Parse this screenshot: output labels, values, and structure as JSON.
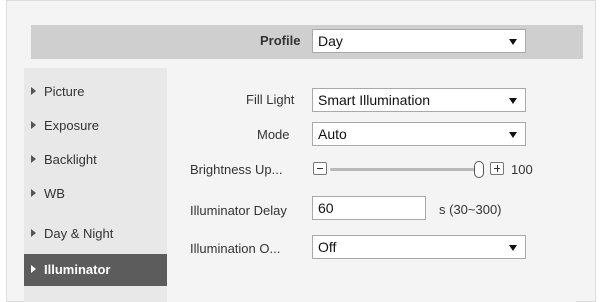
{
  "profile": {
    "label": "Profile",
    "value": "Day"
  },
  "sidebar": {
    "items": [
      {
        "label": "Picture",
        "active": false
      },
      {
        "label": "Exposure",
        "active": false
      },
      {
        "label": "Backlight",
        "active": false
      },
      {
        "label": "WB",
        "active": false
      },
      {
        "label": "Day & Night",
        "active": false
      },
      {
        "label": "Illuminator",
        "active": true
      }
    ]
  },
  "form": {
    "fill_light": {
      "label": "Fill Light",
      "value": "Smart Illumination"
    },
    "mode": {
      "label": "Mode",
      "value": "Auto"
    },
    "brightness": {
      "label": "Brightness Up...",
      "value": "100",
      "level_percent": 100
    },
    "illuminator_delay": {
      "label": "Illuminator Delay",
      "value": "60",
      "hint": "s (30~300)"
    },
    "illumination_o": {
      "label": "Illumination O...",
      "value": "Off"
    }
  },
  "icons": {
    "dropdown": "chevron-down-icon",
    "decrease": "minus-icon",
    "increase": "plus-icon",
    "nav": "caret-right-icon"
  },
  "colors": {
    "active_nav": "#5c5c5c",
    "profile_bar": "#cfcfcf",
    "sidebar": "#e8e8e8"
  }
}
